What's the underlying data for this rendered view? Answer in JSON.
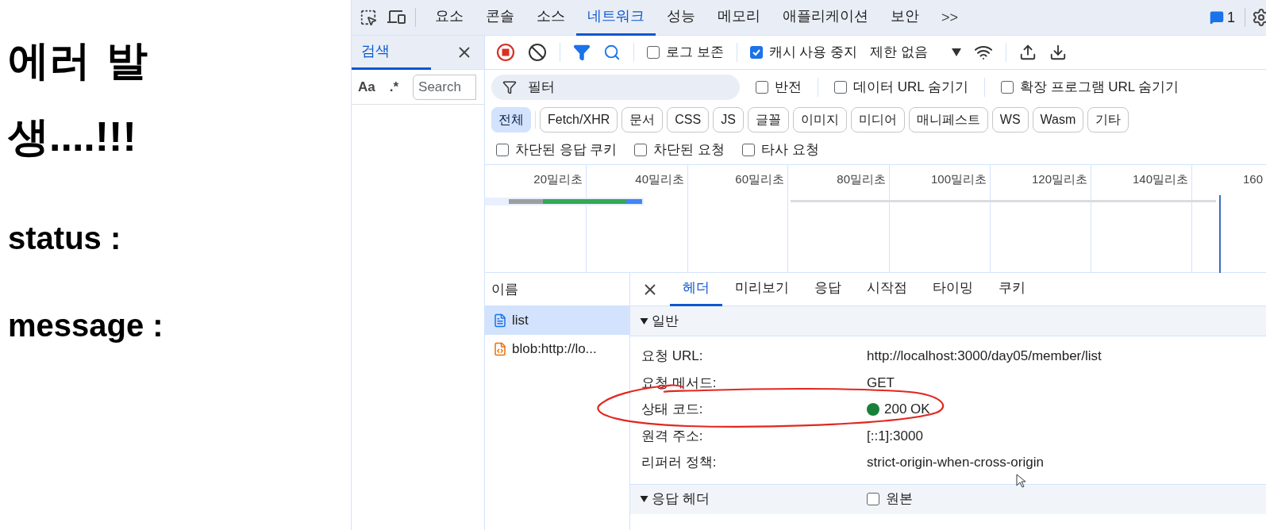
{
  "page": {
    "heading": "에러 발생....!!!",
    "lines": [
      "status :",
      "message :"
    ]
  },
  "devtools": {
    "tabs": [
      {
        "label": "요소",
        "selected": false
      },
      {
        "label": "콘솔",
        "selected": false
      },
      {
        "label": "소스",
        "selected": false
      },
      {
        "label": "네트워크",
        "selected": true
      },
      {
        "label": "성능",
        "selected": false
      },
      {
        "label": "메모리",
        "selected": false
      },
      {
        "label": "애플리케이션",
        "selected": false
      },
      {
        "label": "보안",
        "selected": false
      }
    ],
    "more": ">>",
    "issues_count": "1",
    "search_panel": {
      "tab": "검색",
      "case_toggle": "Aa",
      "regex_toggle": ".*",
      "placeholder": "Search"
    },
    "toolbar": {
      "preserve_log": {
        "label": "로그 보존",
        "checked": false
      },
      "disable_cache": {
        "label": "캐시 사용 중지",
        "checked": true
      },
      "throttling": "제한 없음"
    },
    "filter": {
      "placeholder": "필터",
      "options": [
        {
          "label": "반전",
          "checked": false
        },
        {
          "label": "데이터 URL 숨기기",
          "checked": false
        },
        {
          "label": "확장 프로그램 URL 숨기기",
          "checked": false
        }
      ]
    },
    "type_filters": [
      {
        "label": "전체",
        "selected": true
      },
      {
        "label": "Fetch/XHR",
        "selected": false
      },
      {
        "label": "문서",
        "selected": false
      },
      {
        "label": "CSS",
        "selected": false
      },
      {
        "label": "JS",
        "selected": false
      },
      {
        "label": "글꼴",
        "selected": false
      },
      {
        "label": "이미지",
        "selected": false
      },
      {
        "label": "미디어",
        "selected": false
      },
      {
        "label": "매니페스트",
        "selected": false
      },
      {
        "label": "WS",
        "selected": false
      },
      {
        "label": "Wasm",
        "selected": false
      },
      {
        "label": "기타",
        "selected": false
      }
    ],
    "extra_filters": [
      {
        "label": "차단된 응답 쿠키",
        "checked": false
      },
      {
        "label": "차단된 요청",
        "checked": false
      },
      {
        "label": "타사 요청",
        "checked": false
      }
    ],
    "timeline": {
      "ticks": [
        "20밀리초",
        "40밀리초",
        "60밀리초",
        "80밀리초",
        "100밀리초",
        "120밀리초",
        "140밀리초",
        "160"
      ]
    },
    "requests": {
      "column": "이름",
      "items": [
        {
          "name": "list",
          "kind": "document",
          "selected": true
        },
        {
          "name": "blob:http://lo...",
          "kind": "script",
          "selected": false
        }
      ]
    },
    "details": {
      "tabs": [
        {
          "label": "헤더",
          "selected": true
        },
        {
          "label": "미리보기",
          "selected": false
        },
        {
          "label": "응답",
          "selected": false
        },
        {
          "label": "시작점",
          "selected": false
        },
        {
          "label": "타이밍",
          "selected": false
        },
        {
          "label": "쿠키",
          "selected": false
        }
      ],
      "general": {
        "title": "일반",
        "expanded": true,
        "rows": [
          {
            "key": "요청 URL:",
            "value": "http://localhost:3000/day05/member/list",
            "kind": "text"
          },
          {
            "key": "요청 메서드:",
            "value": "GET",
            "kind": "text"
          },
          {
            "key": "상태 코드:",
            "value": "200 OK",
            "kind": "status"
          },
          {
            "key": "원격 주소:",
            "value": "[::1]:3000",
            "kind": "text"
          },
          {
            "key": "리퍼러 정책:",
            "value": "strict-origin-when-cross-origin",
            "kind": "text"
          }
        ]
      },
      "response_headers": {
        "title": "응답 헤더",
        "expanded": true,
        "raw": {
          "label": "원본",
          "checked": false
        }
      }
    }
  }
}
